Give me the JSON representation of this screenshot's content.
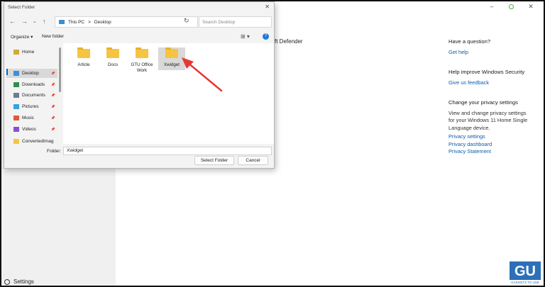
{
  "background": {
    "defender_partial": "ft Defender",
    "side_panel": {
      "question_heading": "Have a question?",
      "get_help": "Get help",
      "improve_heading": "Help improve Windows Security",
      "feedback": "Give us feedback",
      "privacy_heading": "Change your privacy settings",
      "privacy_desc": "View and change privacy settings for your Windows 11 Home Single Language device.",
      "privacy_settings": "Privacy settings",
      "privacy_dashboard": "Privacy dashboard",
      "privacy_statement": "Privacy Statement"
    },
    "settings_label": "Settings"
  },
  "dialog": {
    "title": "Select Folder",
    "address": {
      "root": "This PC",
      "separator": ">",
      "current": "Desktop"
    },
    "search_placeholder": "Search Desktop",
    "organize": "Organize ▾",
    "new_folder": "New folder",
    "nav": [
      {
        "label": "Home",
        "icon": "home-icon",
        "pinned": false
      },
      {
        "label": "Desktop",
        "icon": "desktop-icon",
        "pinned": true,
        "selected": true
      },
      {
        "label": "Downloads",
        "icon": "downloads-icon",
        "pinned": true
      },
      {
        "label": "Documents",
        "icon": "documents-icon",
        "pinned": true
      },
      {
        "label": "Pictures",
        "icon": "pictures-icon",
        "pinned": true
      },
      {
        "label": "Music",
        "icon": "music-icon",
        "pinned": true
      },
      {
        "label": "Videos",
        "icon": "videos-icon",
        "pinned": true
      },
      {
        "label": "ConvertedImag",
        "icon": "folder-icon",
        "pinned": false
      }
    ],
    "folders": [
      {
        "name": "Article"
      },
      {
        "name": "Docs"
      },
      {
        "name": "GTU Office Work"
      },
      {
        "name": "Xwidget",
        "selected": true
      }
    ],
    "folder_label": "Folder:",
    "folder_value": "Xwidget",
    "select_button": "Select Folder",
    "cancel_button": "Cancel"
  },
  "colors": {
    "accent": "#0067c0",
    "link": "#0b5cad",
    "arrow": "#e53935",
    "folder": "#f5c542"
  }
}
